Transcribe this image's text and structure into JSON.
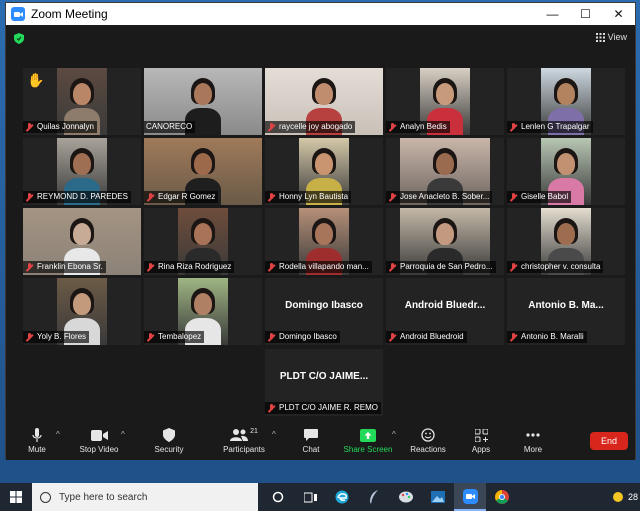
{
  "window": {
    "title": "Zoom Meeting",
    "controls": [
      "—",
      "☐",
      "✕"
    ]
  },
  "meeting": {
    "view_label": "View"
  },
  "participants": [
    {
      "name": "Quilas Jonnalyn",
      "muted": true,
      "hand": true
    },
    {
      "name": "CANORECO",
      "muted": false,
      "active": true
    },
    {
      "name": "raycelle joy abogado",
      "muted": true
    },
    {
      "name": "Analyn Bedis",
      "muted": true
    },
    {
      "name": "Lenlen G Trapalgar",
      "muted": true
    },
    {
      "name": "REYMOND D. PAREDES",
      "muted": true
    },
    {
      "name": "Edgar R Gomez",
      "muted": true
    },
    {
      "name": "Honny Lyn Bautista",
      "muted": true
    },
    {
      "name": "Jose Anacleto B. Sober...",
      "muted": true
    },
    {
      "name": "Giselle Babol",
      "muted": true
    },
    {
      "name": "Franklin Ebona Sr.",
      "muted": true
    },
    {
      "name": "Rina Riza Rodriguez",
      "muted": true
    },
    {
      "name": "Rodella villapando man...",
      "muted": true
    },
    {
      "name": "Parroquia de San Pedro...",
      "muted": true
    },
    {
      "name": "christopher v. consulta",
      "muted": true
    },
    {
      "name": "Yoly B. Flores",
      "muted": true
    },
    {
      "name": "Tembalopez",
      "muted": true
    },
    {
      "name": "Domingo Ibasco",
      "muted": true,
      "no_video": true,
      "display_name": "Domingo Ibasco"
    },
    {
      "name": "Android Bluedroid",
      "muted": true,
      "no_video": true,
      "display_name": "Android  Bluedr..."
    },
    {
      "name": "Antonio   B.  Maralli",
      "muted": true,
      "no_video": true,
      "display_name": "Antonio   B.  Ma..."
    },
    {
      "name": "PLDT C/O JAIME R. REMO",
      "muted": true,
      "no_video": true,
      "display_name": "PLDT C/O JAIME..."
    }
  ],
  "toolbar": {
    "mute": "Mute",
    "stop_video": "Stop Video",
    "security": "Security",
    "participants": "Participants",
    "participants_count": "21",
    "chat": "Chat",
    "share_screen": "Share Screen",
    "reactions": "Reactions",
    "apps": "Apps",
    "more": "More",
    "end": "End"
  },
  "taskbar": {
    "search_placeholder": "Type here to search",
    "clock_partial": "28"
  },
  "colors": {
    "zoom_blue": "#2d8cff",
    "end_red": "#d9261c",
    "share_green": "#23d959",
    "active_speaker": "#c8e660"
  }
}
